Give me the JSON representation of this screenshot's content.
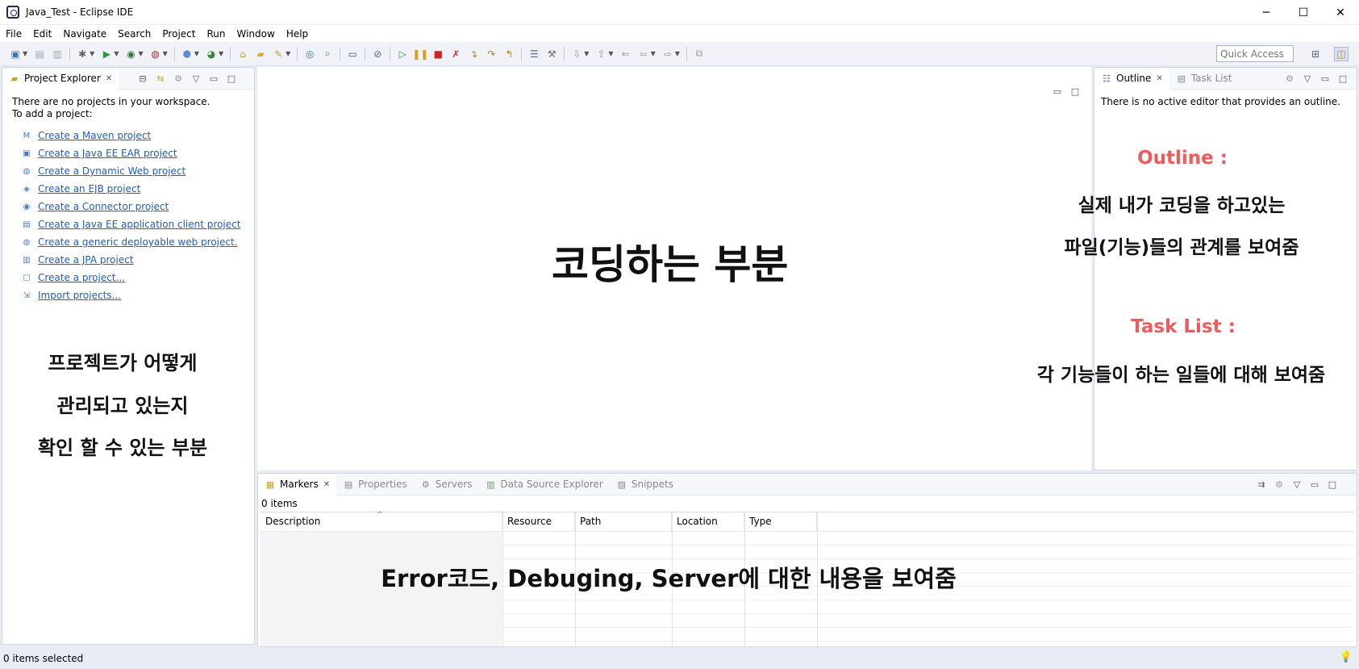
{
  "window": {
    "title": "Java_Test - Eclipse IDE",
    "minimize": "─",
    "maximize": "☐",
    "close": "✕"
  },
  "menu": [
    "File",
    "Edit",
    "Navigate",
    "Search",
    "Project",
    "Run",
    "Window",
    "Help"
  ],
  "toolbar": {
    "quick_access_placeholder": "Quick Access"
  },
  "project_explorer": {
    "tab_label": "Project Explorer",
    "intro_line1": "There are no projects in your workspace.",
    "intro_line2": "To add a project:",
    "links": [
      {
        "label": "Create a Maven project",
        "icon": "maven-icon"
      },
      {
        "label": "Create a Java EE EAR project",
        "icon": "ear-project-icon"
      },
      {
        "label": "Create a Dynamic Web project",
        "icon": "web-project-icon"
      },
      {
        "label": "Create an EJB project",
        "icon": "ejb-project-icon"
      },
      {
        "label": "Create a Connector project",
        "icon": "connector-project-icon"
      },
      {
        "label": "Create a Java EE application client project",
        "icon": "app-client-icon"
      },
      {
        "label": "Create a generic deployable web project.",
        "icon": "deployable-web-icon"
      },
      {
        "label": "Create a JPA project",
        "icon": "jpa-project-icon"
      },
      {
        "label": "Create a project...",
        "icon": "new-project-icon"
      },
      {
        "label": "Import projects...",
        "icon": "import-icon"
      }
    ]
  },
  "outline": {
    "tab_label": "Outline",
    "tab2_label": "Task List",
    "message": "There is no active editor that provides an outline."
  },
  "markers": {
    "tabs": [
      "Markers",
      "Properties",
      "Servers",
      "Data Source Explorer",
      "Snippets"
    ],
    "count": "0 items",
    "columns": [
      "Description",
      "Resource",
      "Path",
      "Location",
      "Type"
    ]
  },
  "status": {
    "text": "0 items selected"
  },
  "annotations": {
    "editor": "코딩하는 부분",
    "project_line1": "프로젝트가 어떻게",
    "project_line2": "관리되고 있는지",
    "project_line3": "확인 할 수 있는 부분",
    "outline_title": "Outline :",
    "outline_line1": "실제 내가 코딩을 하고있는",
    "outline_line2": "파일(기능)들의 관계를 보여줌",
    "tasklist_title": "Task List :",
    "tasklist_line1": "각 기능들이 하는 일들에 대해 보여줌",
    "markers_line": "Error코드, Debuging, Server에 대한 내용을 보여줌"
  }
}
